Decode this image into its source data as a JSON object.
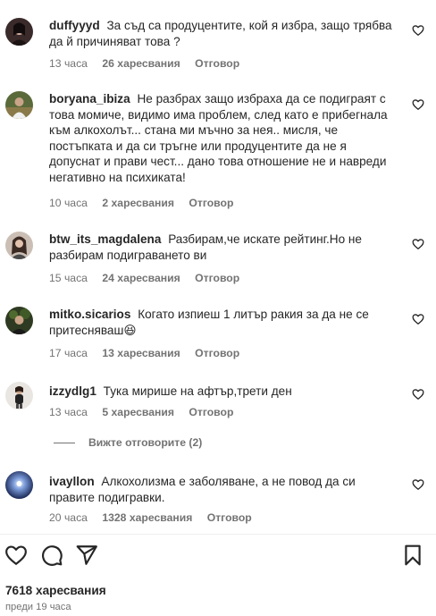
{
  "comments": [
    {
      "username": "duffyyyd",
      "text": "За съд са продуцентите, кой я избра, защо трябва да й причиняват това ?",
      "time": "13 часа",
      "likes": "26 харесвания",
      "reply": "Отговор"
    },
    {
      "username": "boryana_ibiza",
      "text": "Не разбрах защо избраха да се подиграят с това момиче, видимо има проблем, след като е прибегнала към алкохолът... стана ми мъчно за нея.. мисля, че постъпката и да си тръгне или продуцентите да не я допуснат и прави чест... дано това отношение не и навреди негативно на психиката!",
      "time": "10 часа",
      "likes": "2 харесвания",
      "reply": "Отговор"
    },
    {
      "username": "btw_its_magdalena",
      "text": "Разбирам,че искате рейтинг.Но не разбирам подиграването ви",
      "time": "15 часа",
      "likes": "24 харесвания",
      "reply": "Отговор"
    },
    {
      "username": "mitko.sicarios",
      "text": "Когато изпиеш 1 литър ракия за да не се притесняваш😆",
      "time": "17 часа",
      "likes": "13 харесвания",
      "reply": "Отговор"
    },
    {
      "username": "izzydlg1",
      "text": "Тука мирише на афтър,трети ден",
      "time": "13 часа",
      "likes": "5 харесвания",
      "reply": "Отговор"
    },
    {
      "username": "ivayllon",
      "text": "Алкохолизма е заболяване, а не повод да си правите подигравки.",
      "time": "20 часа",
      "likes": "1328 харесвания",
      "reply": "Отговор"
    }
  ],
  "view_replies_label": "Вижте отговорите (2)",
  "actions": {
    "like_icon": "heart-icon",
    "comment_icon": "comment-icon",
    "share_icon": "paper-plane-icon",
    "save_icon": "bookmark-icon"
  },
  "post": {
    "likes_total": "7618 харесвания",
    "time_ago": "преди 19 часа"
  },
  "colors": {
    "text": "#262626",
    "secondary": "#737373",
    "divider": "#efefef"
  }
}
